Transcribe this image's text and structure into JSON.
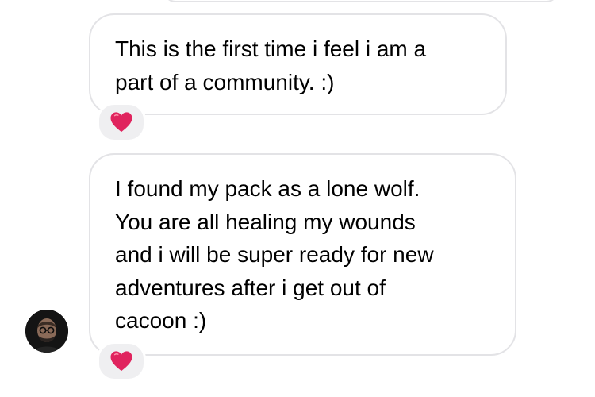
{
  "conversation": {
    "messages": [
      {
        "lines": [
          "This is the first time i feel i am a",
          "part of a community. :)"
        ],
        "reaction": "heart-emoji",
        "reaction_color": "#e0245e"
      },
      {
        "lines": [
          "I found my pack as a lone wolf.",
          "You are all healing my wounds",
          "and i will be super ready for new",
          "adventures after i get out of",
          "cacoon :)"
        ],
        "reaction": "heart-emoji",
        "reaction_color": "#e0245e"
      }
    ],
    "sender_avatar": "profile-photo",
    "bubble_border_color": "#e3e3e6",
    "reaction_bg_color": "#efeff1"
  }
}
